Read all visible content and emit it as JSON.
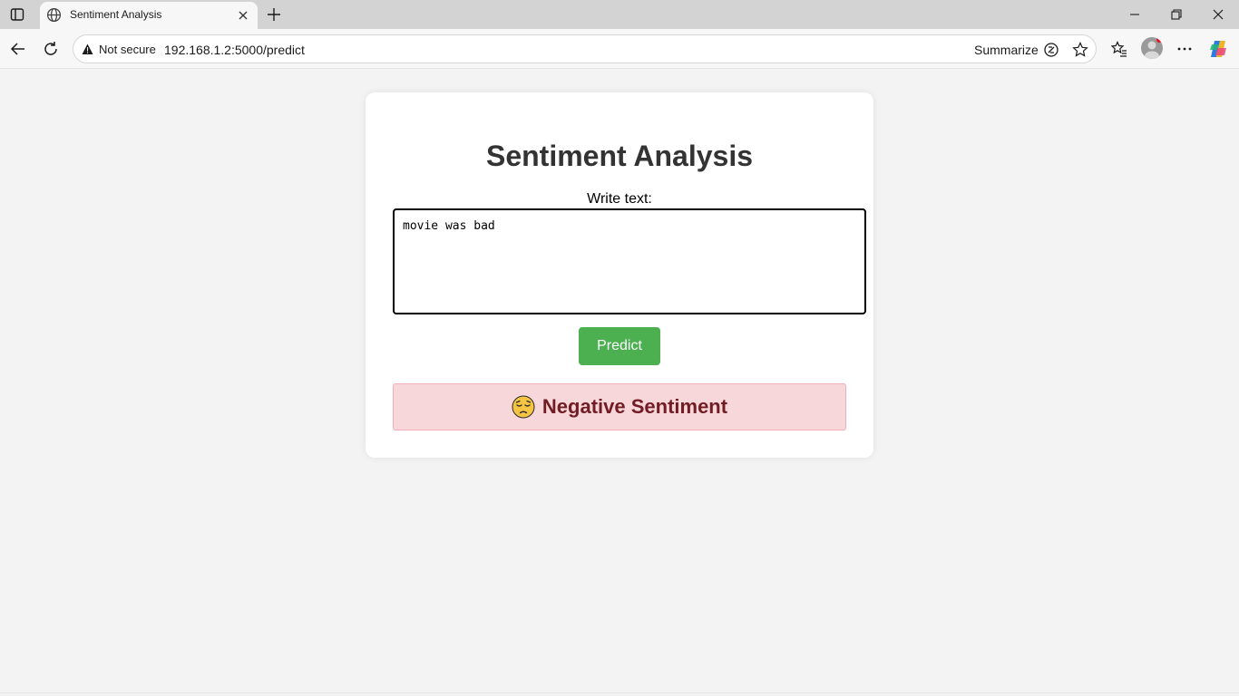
{
  "browser": {
    "tab_title": "Sentiment Analysis",
    "security_label": "Not secure",
    "url": "192.168.1.2:5000/predict",
    "summarize_label": "Summarize"
  },
  "page": {
    "heading": "Sentiment Analysis",
    "input_label": "Write text:",
    "input_value": "movie was bad",
    "button_label": "Predict",
    "result_text": "Negative Sentiment",
    "result_icon": "pensive-face-emoji"
  },
  "colors": {
    "button": "#4caf50",
    "result_bg": "#f8d7da",
    "result_text": "#721c24"
  }
}
